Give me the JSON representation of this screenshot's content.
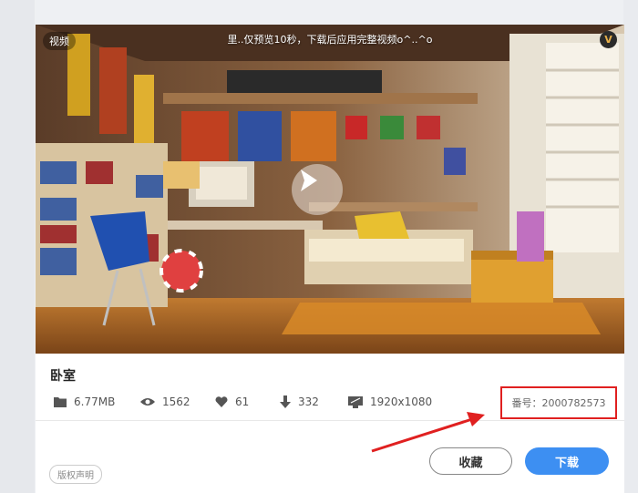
{
  "preview": {
    "badge": "视频",
    "notice": "里..仅预览10秒，下载后应用完整视频o^..^o",
    "vip_label": "V"
  },
  "item": {
    "title": "卧室",
    "size": "6.77MB",
    "views": "1562",
    "likes": "61",
    "downloads": "332",
    "resolution": "1920x1080",
    "serial": "番号：2000782573"
  },
  "actions": {
    "copyright": "版权声明",
    "favorite": "收藏",
    "download": "下载"
  },
  "colors": {
    "accent": "#3d8ff2",
    "highlight_box": "#e02020"
  },
  "icons": [
    "folder-icon",
    "eye-icon",
    "heart-icon",
    "download-arrow-icon",
    "monitor-icon",
    "play-icon",
    "vip-icon"
  ]
}
